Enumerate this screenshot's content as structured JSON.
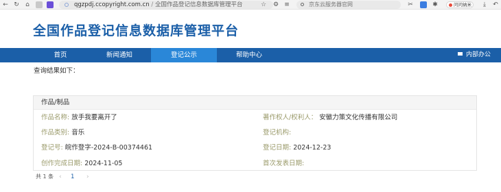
{
  "browser": {
    "url_domain": "qgzpdj.ccopyright.com.cn",
    "url_separator": "/",
    "tab_title": "全国作品登记信息数据库管理平台",
    "search_text": "京东云服务器官网",
    "profile_label": "问问纳米"
  },
  "site": {
    "title": "全国作品登记信息数据库管理平台"
  },
  "nav": {
    "items": [
      "首页",
      "新闻通知",
      "登记公示",
      "帮助中心"
    ],
    "active_index": 2,
    "right_label": "内部办公"
  },
  "results": {
    "heading": "查询结果如下：",
    "card_title": "作品/制品",
    "fields": {
      "work_name": {
        "label": "作品名称:",
        "value": "放手我要离开了"
      },
      "copyright_owner": {
        "label": "著作权人/权利人：",
        "value": "安徽力策文化传播有限公司"
      },
      "work_category": {
        "label": "作品类别:",
        "value": "音乐"
      },
      "reg_agency": {
        "label": "登记机构:",
        "value": ""
      },
      "reg_number": {
        "label": "登记号:",
        "value": "皖作登字-2024-B-00374461"
      },
      "reg_date": {
        "label": "登记日期:",
        "value": "2024-12-23"
      },
      "creation_date": {
        "label": "创作完成日期:",
        "value": "2024-11-05"
      },
      "first_publish_date": {
        "label": "首次发表日期:",
        "value": ""
      }
    }
  },
  "pagination": {
    "total_text": "共 1 条",
    "prev": "‹",
    "current_page": "1",
    "next": "›"
  },
  "colors": {
    "brand_blue": "#1b5fa8",
    "active_nav": "#2a87d8",
    "label_olive": "#9a9a6a"
  }
}
